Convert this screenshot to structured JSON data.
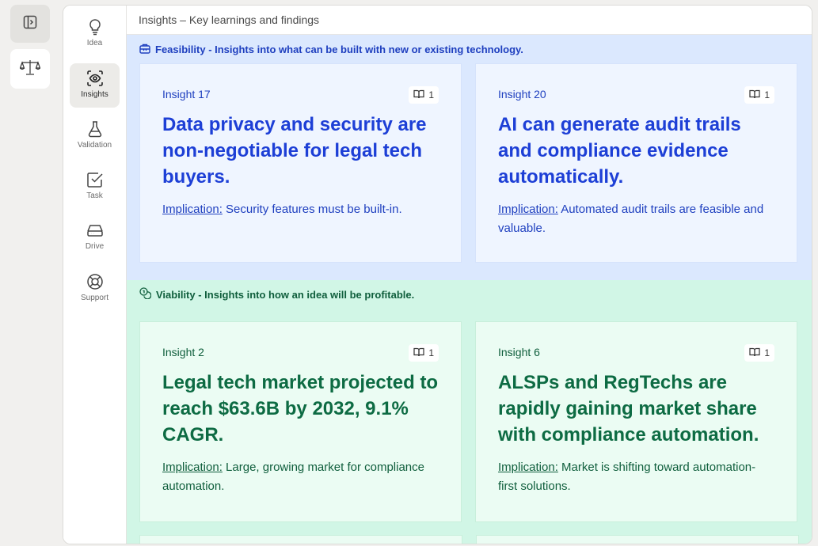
{
  "rail": {
    "toggle_icon": "sidebar-toggle-icon",
    "logo_icon": "scales-icon"
  },
  "nav": {
    "items": [
      {
        "label": "Idea",
        "icon": "lightbulb-icon"
      },
      {
        "label": "Insights",
        "icon": "eye-scan-icon",
        "active": true
      },
      {
        "label": "Validation",
        "icon": "flask-icon"
      },
      {
        "label": "Task",
        "icon": "checkbox-icon"
      },
      {
        "label": "Drive",
        "icon": "drive-icon"
      },
      {
        "label": "Support",
        "icon": "lifebuoy-icon"
      }
    ]
  },
  "header": {
    "title": "Insights – Key learnings and findings"
  },
  "sections": {
    "feasibility": {
      "heading": "Feasibility - Insights into what can be built with new or existing technology.",
      "color": "#1e3fbf",
      "cards": [
        {
          "number": "Insight 17",
          "count": "1",
          "title": "Data privacy and security are non-negotiable for legal tech buyers.",
          "implication_label": "Implication:",
          "implication": " Security features must be built-in."
        },
        {
          "number": "Insight 20",
          "count": "1",
          "title": "AI can generate audit trails and compliance evidence automatically.",
          "implication_label": "Implication:",
          "implication": " Automated audit trails are feasible and valuable."
        }
      ]
    },
    "viability": {
      "heading": "Viability - Insights into how an idea will be profitable.",
      "color": "#0f5e3c",
      "cards": [
        {
          "number": "Insight 2",
          "count": "1",
          "title": "Legal tech market projected to reach $63.6B by 2032, 9.1% CAGR.",
          "implication_label": "Implication:",
          "implication": " Large, growing market for compliance automation."
        },
        {
          "number": "Insight 6",
          "count": "1",
          "title": "ALSPs and RegTechs are rapidly gaining market share with compliance automation.",
          "implication_label": "Implication:",
          "implication": " Market is shifting toward automation-first solutions."
        }
      ]
    }
  }
}
